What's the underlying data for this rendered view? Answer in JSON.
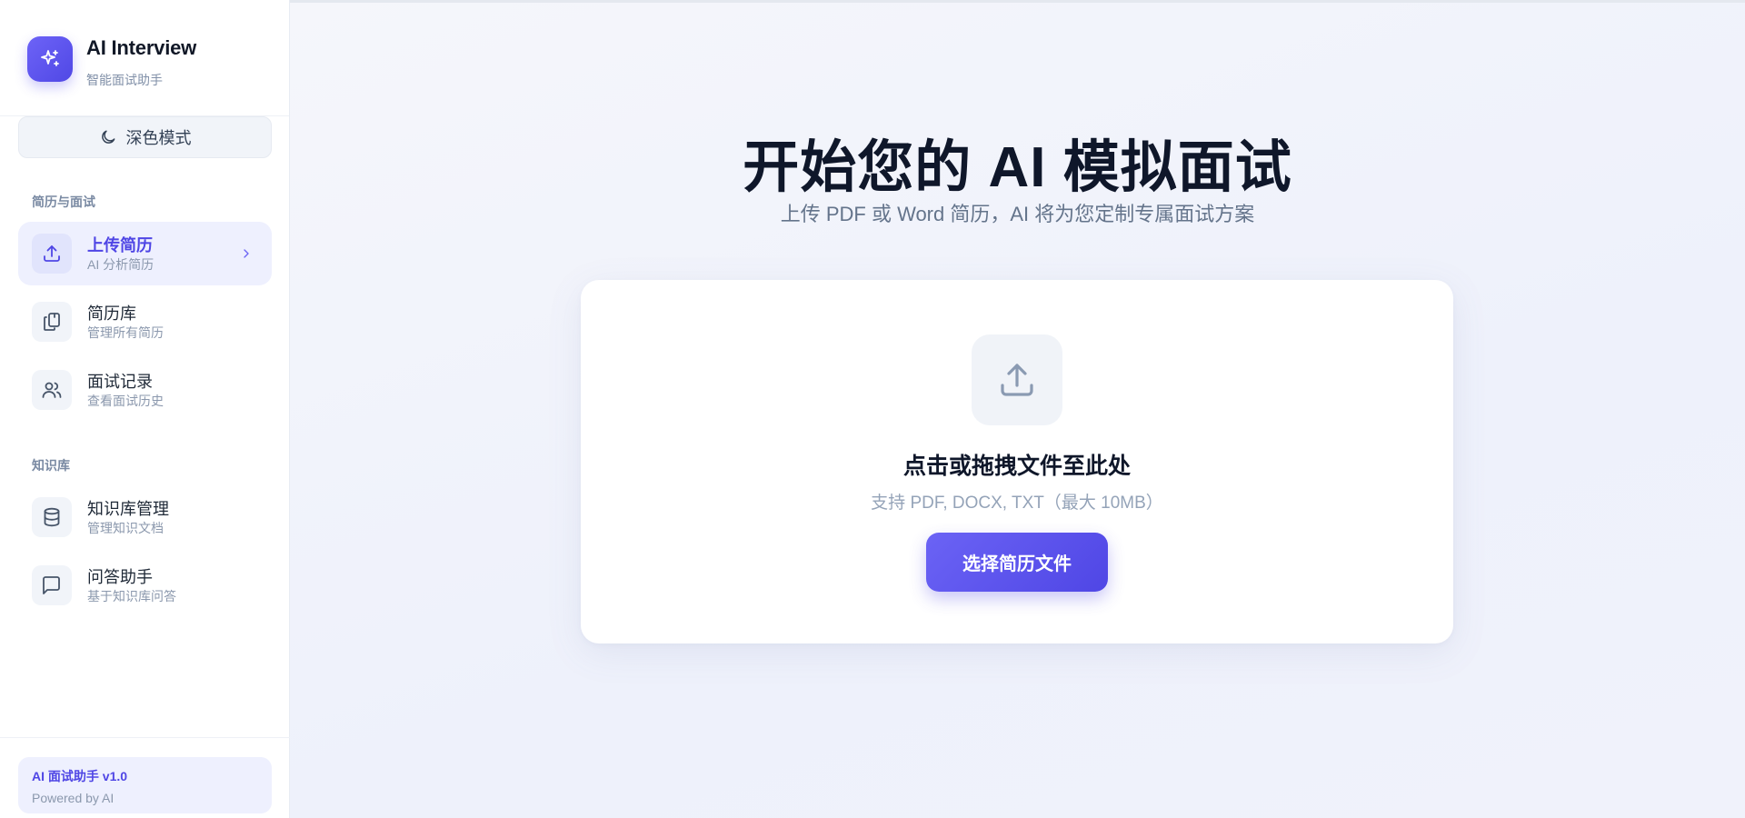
{
  "brand": {
    "title": "AI Interview",
    "subtitle": "智能面试助手"
  },
  "theme_toggle": {
    "label": "深色模式",
    "icon": "moon-icon"
  },
  "sections": {
    "resume_interview": "简历与面试",
    "knowledge": "知识库"
  },
  "nav": [
    {
      "id": "upload",
      "title": "上传简历",
      "sub": "AI 分析简历",
      "icon": "upload-icon",
      "active": true
    },
    {
      "id": "library",
      "title": "简历库",
      "sub": "管理所有简历",
      "icon": "documents-icon",
      "active": false
    },
    {
      "id": "records",
      "title": "面试记录",
      "sub": "查看面试历史",
      "icon": "users-icon",
      "active": false
    },
    {
      "id": "kb-manage",
      "title": "知识库管理",
      "sub": "管理知识文档",
      "icon": "database-icon",
      "active": false
    },
    {
      "id": "qa",
      "title": "问答助手",
      "sub": "基于知识库问答",
      "icon": "chat-icon",
      "active": false
    }
  ],
  "footer": {
    "version": "AI 面试助手 v1.0",
    "powered": "Powered by AI"
  },
  "hero": {
    "title": "开始您的 AI 模拟面试",
    "subtitle": "上传 PDF 或 Word 简历，AI 将为您定制专属面试方案"
  },
  "upload": {
    "title": "点击或拖拽文件至此处",
    "hint": "支持 PDF, DOCX, TXT（最大 10MB）",
    "button": "选择简历文件"
  },
  "colors": {
    "accent": "#4f46e5",
    "accent_light": "#eef0fe",
    "text_dark": "#0f172a",
    "text_muted": "#8b98ad"
  }
}
